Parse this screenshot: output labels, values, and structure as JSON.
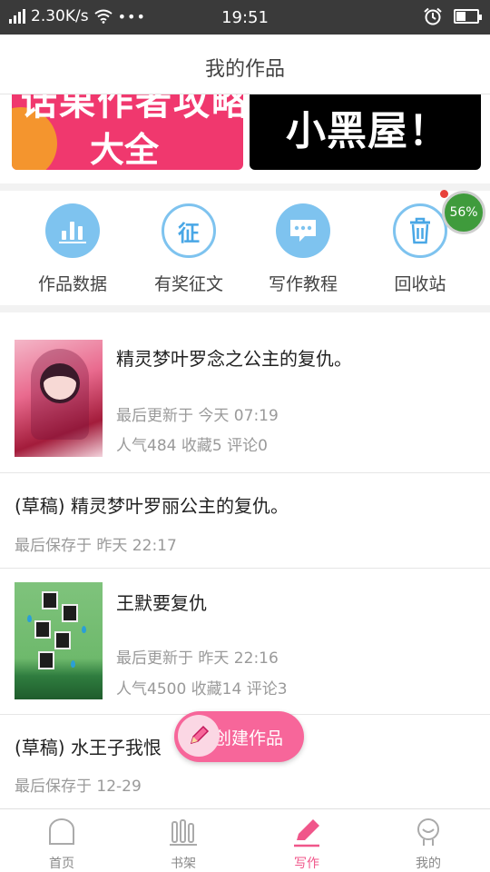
{
  "status_bar": {
    "speed": "2.30K/s",
    "dots": "•••",
    "time": "19:51",
    "battery_level": 0.45
  },
  "header": {
    "title": "我的作品"
  },
  "banners": {
    "left": {
      "line1": "话果作者攻略",
      "line2": "大全"
    },
    "right": {
      "text": "小黑屋！"
    }
  },
  "quick_actions": [
    {
      "label": "作品数据",
      "icon": "bar-chart-icon"
    },
    {
      "label": "有奖征文",
      "icon": "zheng-badge-icon",
      "glyph": "征"
    },
    {
      "label": "写作教程",
      "icon": "chat-bubble-icon"
    },
    {
      "label": "回收站",
      "icon": "trash-icon"
    }
  ],
  "progress_badge": "56%",
  "works": [
    {
      "title": "精灵梦叶罗念之公主的复仇。",
      "updated": "最后更新于 今天 07:19",
      "stats": "人气484  收藏5  评论0"
    },
    {
      "title": "(草稿) 精灵梦叶罗丽公主的复仇。",
      "saved": "最后保存于 昨天 22:17"
    },
    {
      "title": "王默要复仇",
      "updated": "最后更新于 昨天 22:16",
      "stats": "人气4500  收藏14  评论3"
    },
    {
      "title": "(草稿) 水王子我恨",
      "saved": "最后保存于 12-29"
    }
  ],
  "fab": {
    "label": "创建作品"
  },
  "bottom_nav": [
    {
      "label": "首页",
      "icon": "home-icon"
    },
    {
      "label": "书架",
      "icon": "bookshelf-icon"
    },
    {
      "label": "写作",
      "icon": "write-pencil-icon"
    },
    {
      "label": "我的",
      "icon": "profile-icon"
    }
  ],
  "colors": {
    "accent": "#f0568a",
    "icon_blue": "#7ec3ef",
    "banner_pink": "#f0386e"
  }
}
